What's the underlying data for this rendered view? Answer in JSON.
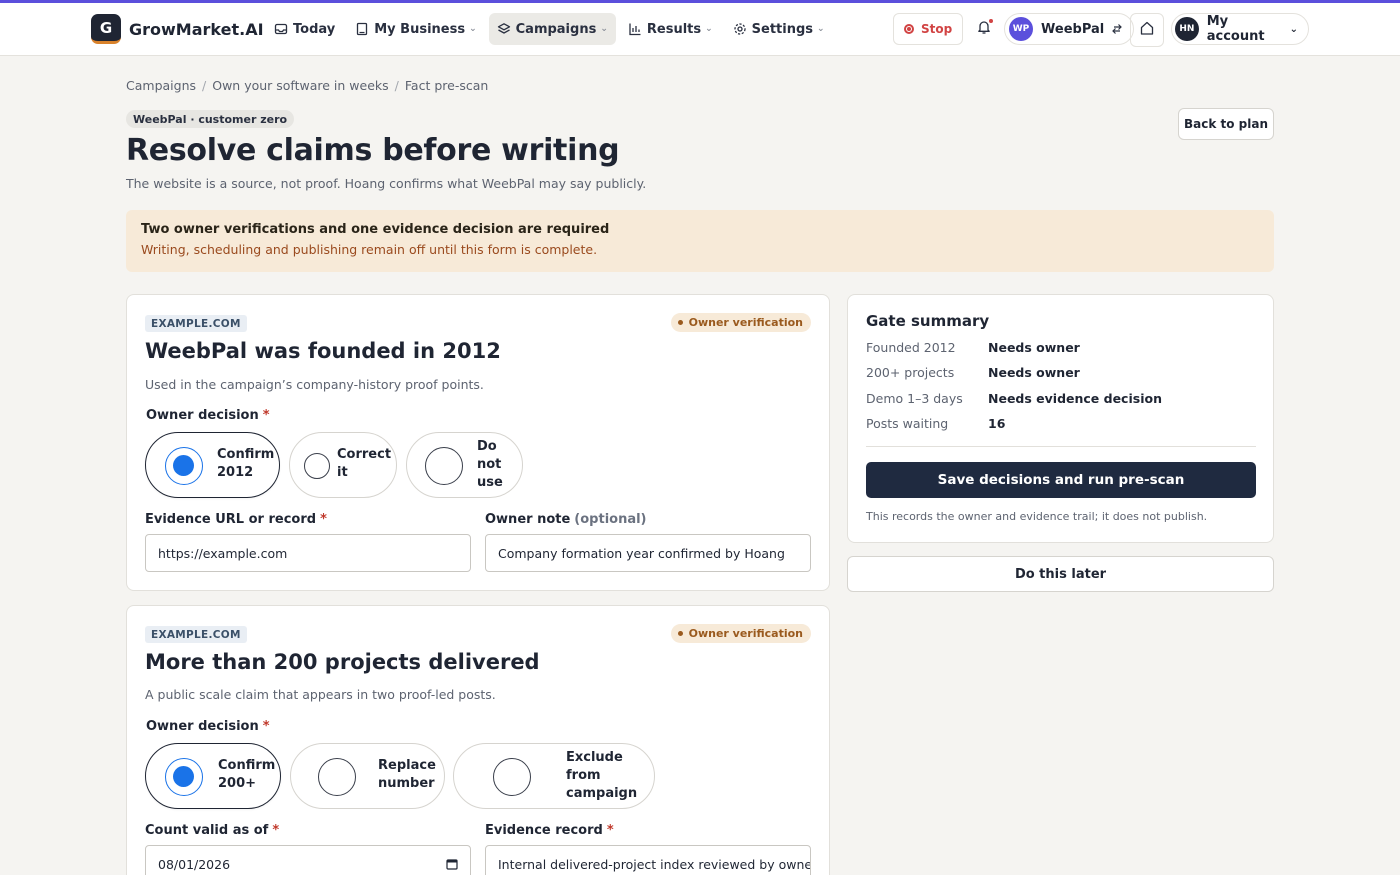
{
  "brand": {
    "logo_letter": "G",
    "name": "GrowMarket.AI"
  },
  "nav": [
    {
      "label": "Today",
      "icon": "inbox-icon",
      "has_menu": false
    },
    {
      "label": "My Business",
      "icon": "book-icon",
      "has_menu": true
    },
    {
      "label": "Campaigns",
      "icon": "layers-icon",
      "has_menu": true,
      "active": true
    },
    {
      "label": "Results",
      "icon": "bar-chart-icon",
      "has_menu": true
    },
    {
      "label": "Settings",
      "icon": "gear-icon",
      "has_menu": true
    }
  ],
  "topbar": {
    "stop_label": "Stop",
    "workspace_initials": "WP",
    "workspace_name": "WeebPal",
    "account_initials": "HN",
    "account_label": "My account"
  },
  "breadcrumb": [
    "Campaigns",
    "Own your software in weeks",
    "Fact pre-scan"
  ],
  "header": {
    "tag": "WeebPal · customer zero",
    "title": "Resolve claims before writing",
    "subtitle": "The website is a source, not proof. Hoang confirms what WeebPal may say publicly.",
    "back_label": "Back to plan"
  },
  "alert": {
    "title": "Two owner verifications and one evidence decision are required",
    "body": "Writing, scheduling and publishing remain off until this form is complete."
  },
  "claims": [
    {
      "source": "EXAMPLE.COM",
      "status": "Owner verification",
      "title": "WeebPal was founded in 2012",
      "description": "Used in the campaign’s company-history proof points.",
      "decision_label": "Owner decision",
      "options": [
        "Confirm 2012",
        "Correct it",
        "Do not use"
      ],
      "selected": "Confirm 2012",
      "field_a_label": "Evidence URL or record",
      "field_a_value": "https://example.com",
      "field_b_label": "Owner note",
      "field_b_optional": "(optional)",
      "field_b_value": "Company formation year confirmed by Hoang"
    },
    {
      "source": "EXAMPLE.COM",
      "status": "Owner verification",
      "title": "More than 200 projects delivered",
      "description": "A public scale claim that appears in two proof-led posts.",
      "decision_label": "Owner decision",
      "options": [
        "Confirm 200+",
        "Replace number",
        "Exclude from campaign"
      ],
      "selected": "Confirm 200+",
      "field_a_label": "Count valid as of",
      "field_a_value": "08/01/2026",
      "field_b_label": "Evidence record",
      "field_b_value": "Internal delivered-project index reviewed by owner"
    }
  ],
  "summary": {
    "title": "Gate summary",
    "rows": [
      {
        "key": "Founded 2012",
        "value": "Needs owner"
      },
      {
        "key": "200+ projects",
        "value": "Needs owner"
      },
      {
        "key": "Demo 1–3 days",
        "value": "Needs evidence decision"
      },
      {
        "key": "Posts waiting",
        "value": "16"
      }
    ],
    "primary_label": "Save decisions and run pre-scan",
    "note": "This records the owner and evidence trail; it does not publish."
  },
  "later_label": "Do this later",
  "required_marker": "*",
  "colors": {
    "accent": "#5b4fdc",
    "primary": "#1f2a40",
    "warning_bg": "#f7ead8",
    "radio_selected": "#1a73e8",
    "danger": "#d14343"
  }
}
